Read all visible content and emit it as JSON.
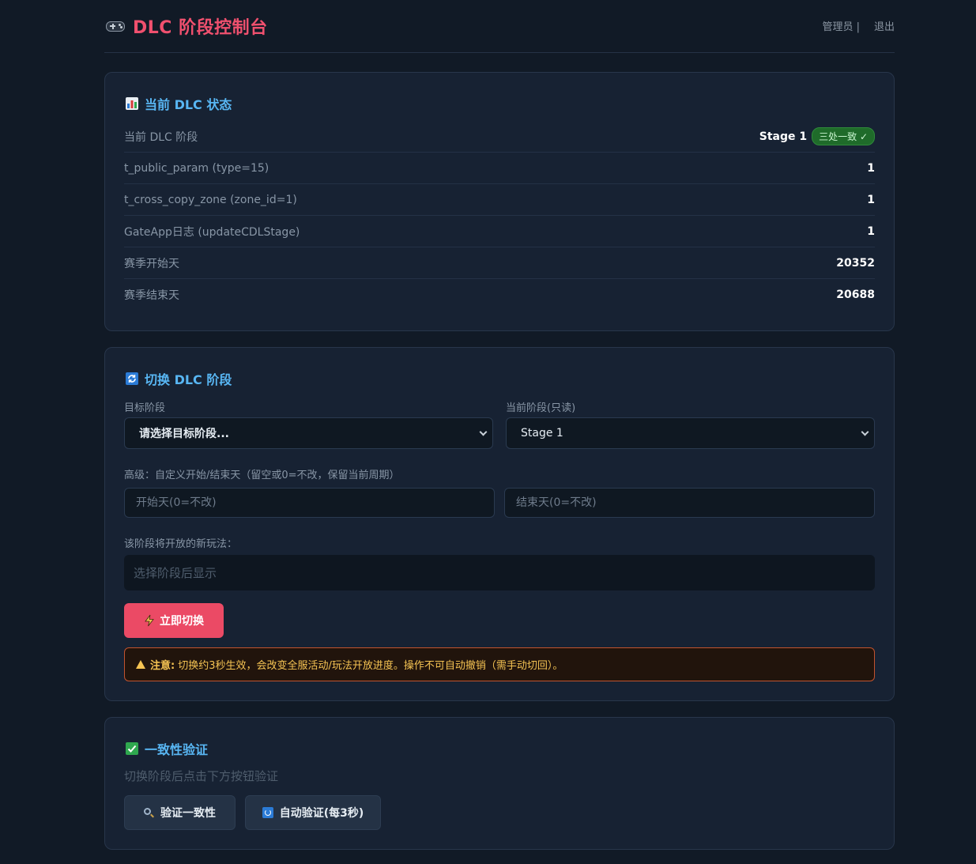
{
  "header": {
    "title": "DLC 阶段控制台",
    "user": "管理员 |",
    "logout": "退出"
  },
  "status": {
    "title": "当前 DLC 状态",
    "rows": [
      {
        "label": "当前 DLC 阶段",
        "value": "Stage 1",
        "badge": "三处一致 ✓"
      },
      {
        "label": "t_public_param (type=15)",
        "value": "1"
      },
      {
        "label": "t_cross_copy_zone (zone_id=1)",
        "value": "1"
      },
      {
        "label": "GateApp日志 (updateCDLStage)",
        "value": "1"
      },
      {
        "label": "赛季开始天",
        "value": "20352"
      },
      {
        "label": "赛季结束天",
        "value": "20688"
      }
    ]
  },
  "switch": {
    "title": "切换 DLC 阶段",
    "target_label": "目标阶段",
    "target_value": "请选择目标阶段...",
    "current_label": "当前阶段(只读)",
    "current_value": "Stage 1",
    "advanced_label": "高级：自定义开始/结束天（留空或0=不改，保留当前周期）",
    "start_placeholder": "开始天(0=不改)",
    "end_placeholder": "结束天(0=不改)",
    "preview_label": "该阶段将开放的新玩法：",
    "preview_text": "选择阶段后显示",
    "submit_label": "立即切换",
    "warning_prefix": "注意:",
    "warning_text": "切换约3秒生效，会改变全服活动/玩法开放进度。操作不可自动撤销（需手动切回）。"
  },
  "verify": {
    "title": "一致性验证",
    "hint": "切换阶段后点击下方按钮验证",
    "verify_button": "验证一致性",
    "auto_button": "自动验证(每3秒)"
  },
  "colors": {
    "accent_red": "#eb4a65",
    "title_blue": "#58b6f3",
    "badge_green": "#1f6b2a",
    "warning_yellow": "#f6c453"
  },
  "icons": [
    "gamepad-icon",
    "bar-chart-icon",
    "refresh-icon",
    "lightning-icon",
    "warning-icon",
    "checkmark-icon",
    "magnifier-icon"
  ]
}
